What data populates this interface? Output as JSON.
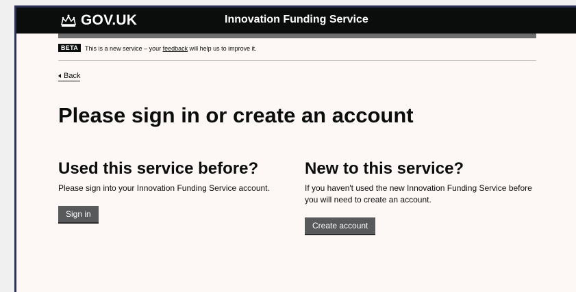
{
  "header": {
    "logo_text": "GOV.UK",
    "service_name": "Innovation Funding Service"
  },
  "beta_banner": {
    "tag": "BETA",
    "text_before": "This is a new service – your ",
    "link_text": "feedback",
    "text_after": " will help us to improve it."
  },
  "back_link": {
    "label": "Back"
  },
  "page_title": "Please sign in or create an account",
  "sign_in_section": {
    "heading": "Used this service before?",
    "body": "Please sign into your Innovation Funding Service account.",
    "button_label": "Sign in"
  },
  "create_section": {
    "heading": "New to this service?",
    "body": "If you haven't used the new Innovation Funding Service before you will need to create an account.",
    "button_label": "Create account"
  },
  "colors": {
    "header_bg": "#0b0c0c",
    "page_bg": "#fdf8f5",
    "button_bg": "#58595b"
  },
  "icons": {
    "logo": "crown-icon",
    "back": "triangle-left-icon"
  }
}
